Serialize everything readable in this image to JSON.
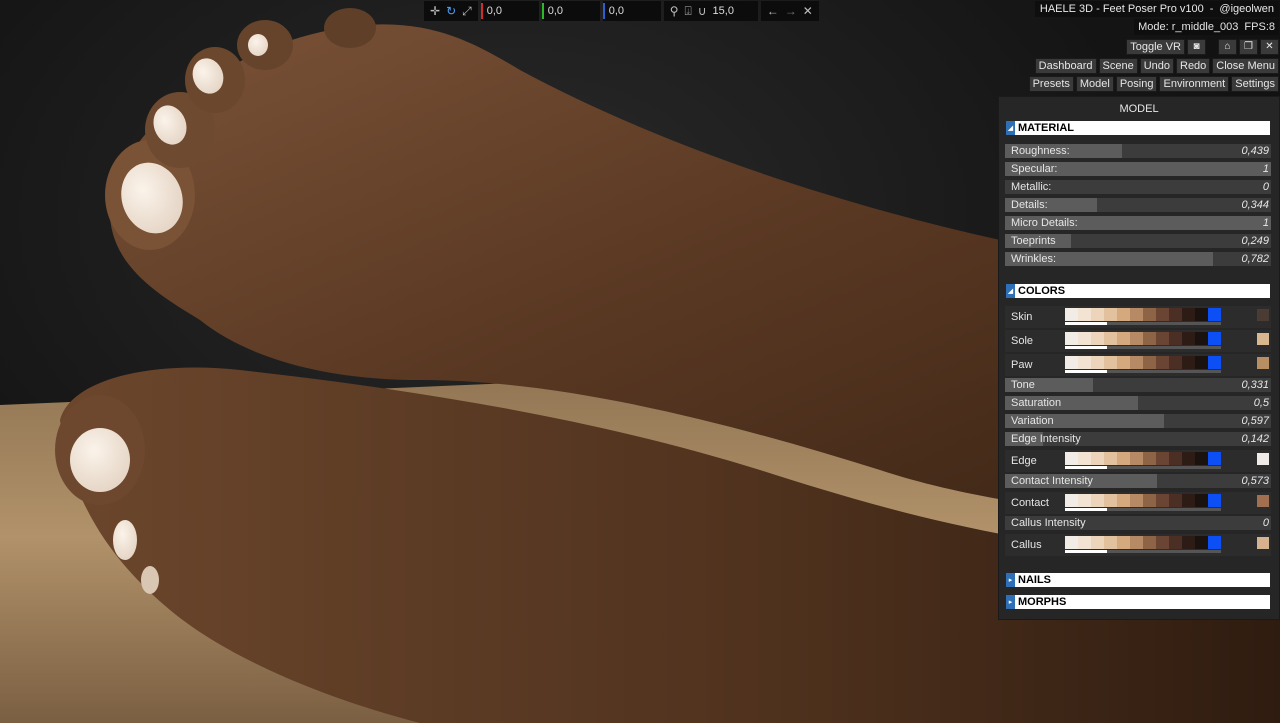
{
  "app": {
    "title": "HAELE 3D - Feet Poser Pro v100",
    "author": "@igeolwen",
    "mode": "Mode: r_middle_003",
    "fps": "FPS:8"
  },
  "toolbar": {
    "x": "0,0",
    "y": "0,0",
    "z": "0,0",
    "snap_value": "15,0",
    "axis_colors": [
      "#d12b2b",
      "#2bb82b",
      "#2b5fd1"
    ]
  },
  "top_buttons": {
    "toggle_vr": "Toggle VR",
    "nav": [
      "Dashboard",
      "Scene",
      "Undo",
      "Redo",
      "Close Menu"
    ],
    "tabs": [
      "Presets",
      "Model",
      "Posing",
      "Environment",
      "Settings"
    ]
  },
  "panel": {
    "title": "MODEL",
    "sections": {
      "material": "MATERIAL",
      "colors": "COLORS",
      "nails": "NAILS",
      "morphs": "MORPHS"
    },
    "material": [
      {
        "label": "Roughness:",
        "value": "0,439",
        "fill": 0.439
      },
      {
        "label": "Specular:",
        "value": "1",
        "fill": 1.0
      },
      {
        "label": "Metallic:",
        "value": "0",
        "fill": 0.0
      },
      {
        "label": "Details:",
        "value": "0,344",
        "fill": 0.344
      },
      {
        "label": "Micro Details:",
        "value": "1",
        "fill": 1.0
      },
      {
        "label": "Toeprints",
        "value": "0,249",
        "fill": 0.249
      },
      {
        "label": "Wrinkles:",
        "value": "0,782",
        "fill": 0.782
      }
    ],
    "palette": [
      "#f2ece6",
      "#f3e3d2",
      "#ecd5bb",
      "#e2c19f",
      "#d4a97e",
      "#b58a64",
      "#8e6446",
      "#6b4534",
      "#4c2f24",
      "#2d1c16",
      "#1a120e",
      "#0b4ff5"
    ],
    "colors": [
      {
        "type": "palette",
        "label": "Skin",
        "knob": 0.27,
        "current": "#4a3b33"
      },
      {
        "type": "palette",
        "label": "Sole",
        "knob": 0.27,
        "current": "#d9b88f"
      },
      {
        "type": "palette",
        "label": "Paw",
        "knob": 0.27,
        "current": "#b88e64"
      },
      {
        "type": "slider",
        "label": "Tone",
        "value": "0,331",
        "fill": 0.331
      },
      {
        "type": "slider",
        "label": "Saturation",
        "value": "0,5",
        "fill": 0.5
      },
      {
        "type": "slider",
        "label": "Variation",
        "value": "0,597",
        "fill": 0.597
      },
      {
        "type": "slider",
        "label": "Edge Intensity",
        "value": "0,142",
        "fill": 0.142
      },
      {
        "type": "palette",
        "label": "Edge",
        "knob": 0.27,
        "current": "#f1ebe7"
      },
      {
        "type": "slider",
        "label": "Contact Intensity",
        "value": "0,573",
        "fill": 0.573
      },
      {
        "type": "palette",
        "label": "Contact",
        "knob": 0.27,
        "current": "#a07050"
      },
      {
        "type": "slider",
        "label": "Callus Intensity",
        "value": "0",
        "fill": 0.0
      },
      {
        "type": "palette",
        "label": "Callus",
        "knob": 0.27,
        "current": "#d6b38e"
      }
    ]
  }
}
